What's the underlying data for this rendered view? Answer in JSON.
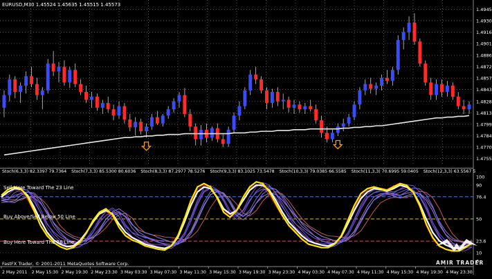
{
  "window": {
    "header": "EURUSD,M30 1.45524 1.45635 1.45515 1.45573",
    "copyright": "FastFX Trader, © 2001-2011 MetaQuotes Software Corp."
  },
  "watermark": {
    "text": "AMIR TRADER"
  },
  "colors": {
    "background": "#000000",
    "bull": "#3a4bff",
    "bear": "#ff2a2a",
    "ma": "#e8e8e8",
    "grid": "#8a8a8a",
    "axis_text": "#ffffff",
    "arrow": "#ff9a00",
    "level_high": "#3c78d8",
    "level_mid": "#e0c020",
    "level_low": "#ff3030"
  },
  "chart_data": [
    {
      "type": "candlestick",
      "title": "EURUSD,M30 1.45524 1.45635 1.45515 1.45573",
      "y_ticks": [
        "1.4945",
        "1.49305",
        "1.4916",
        "1.49015",
        "1.48865",
        "1.4872",
        "1.48575",
        "1.4843",
        "1.4828",
        "1.48135",
        "1.4799",
        "1.47845",
        "1.4770",
        "1.47555"
      ],
      "ylim": [
        1.4748,
        1.4955
      ],
      "candles": [
        [
          1.482,
          1.4842,
          1.4808,
          1.4836
        ],
        [
          1.4836,
          1.4862,
          1.4828,
          1.4856
        ],
        [
          1.4856,
          1.486,
          1.4832,
          1.484
        ],
        [
          1.484,
          1.4852,
          1.4826,
          1.4848
        ],
        [
          1.4848,
          1.4866,
          1.4838,
          1.486
        ],
        [
          1.486,
          1.4872,
          1.4846,
          1.485
        ],
        [
          1.485,
          1.4858,
          1.483,
          1.4836
        ],
        [
          1.4836,
          1.4846,
          1.4818,
          1.4842
        ],
        [
          1.4842,
          1.4882,
          1.4838,
          1.4876
        ],
        [
          1.4876,
          1.4892,
          1.486,
          1.4866
        ],
        [
          1.4866,
          1.4878,
          1.4852,
          1.4872
        ],
        [
          1.4872,
          1.488,
          1.4848,
          1.4852
        ],
        [
          1.4852,
          1.4872,
          1.4845,
          1.4868
        ],
        [
          1.4868,
          1.4876,
          1.4846,
          1.485
        ],
        [
          1.485,
          1.4856,
          1.4836,
          1.484
        ],
        [
          1.484,
          1.4848,
          1.4826,
          1.483
        ],
        [
          1.483,
          1.484,
          1.482,
          1.4834
        ],
        [
          1.4834,
          1.4838,
          1.4816,
          1.482
        ],
        [
          1.482,
          1.483,
          1.4812,
          1.4826
        ],
        [
          1.4826,
          1.4834,
          1.4814,
          1.4818
        ],
        [
          1.4818,
          1.4824,
          1.4804,
          1.481
        ],
        [
          1.481,
          1.4828,
          1.4806,
          1.4822
        ],
        [
          1.4822,
          1.4826,
          1.48,
          1.4805
        ],
        [
          1.4805,
          1.4812,
          1.479,
          1.4795
        ],
        [
          1.4795,
          1.4808,
          1.4785,
          1.4802
        ],
        [
          1.4802,
          1.4806,
          1.4786,
          1.479
        ],
        [
          1.479,
          1.48,
          1.4782,
          1.4796
        ],
        [
          1.4796,
          1.4812,
          1.4792,
          1.4808
        ],
        [
          1.4808,
          1.4816,
          1.4798,
          1.48
        ],
        [
          1.48,
          1.4812,
          1.4796,
          1.481
        ],
        [
          1.481,
          1.4822,
          1.4806,
          1.4818
        ],
        [
          1.4818,
          1.4832,
          1.4814,
          1.4828
        ],
        [
          1.4828,
          1.484,
          1.482,
          1.4836
        ],
        [
          1.4836,
          1.4845,
          1.4808,
          1.4812
        ],
        [
          1.4812,
          1.4818,
          1.479,
          1.4796
        ],
        [
          1.4796,
          1.48,
          1.4772,
          1.478
        ],
        [
          1.478,
          1.4798,
          1.4772,
          1.4792
        ],
        [
          1.4792,
          1.48,
          1.4776,
          1.4782
        ],
        [
          1.4782,
          1.4796,
          1.4778,
          1.4794
        ],
        [
          1.4794,
          1.48,
          1.4776,
          1.478
        ],
        [
          1.478,
          1.4786,
          1.477,
          1.4774
        ],
        [
          1.4774,
          1.4796,
          1.477,
          1.4792
        ],
        [
          1.4792,
          1.4814,
          1.4788,
          1.481
        ],
        [
          1.481,
          1.4828,
          1.4804,
          1.4822
        ],
        [
          1.4822,
          1.4846,
          1.4818,
          1.4842
        ],
        [
          1.4842,
          1.4868,
          1.4836,
          1.4862
        ],
        [
          1.4862,
          1.4872,
          1.485,
          1.4856
        ],
        [
          1.4856,
          1.486,
          1.4838,
          1.4842
        ],
        [
          1.4842,
          1.4846,
          1.4818,
          1.4826
        ],
        [
          1.4826,
          1.4844,
          1.482,
          1.484
        ],
        [
          1.484,
          1.4846,
          1.4822,
          1.4828
        ],
        [
          1.4828,
          1.4838,
          1.4818,
          1.483
        ],
        [
          1.483,
          1.4834,
          1.4814,
          1.482
        ],
        [
          1.482,
          1.483,
          1.4812,
          1.4824
        ],
        [
          1.4824,
          1.4828,
          1.4814,
          1.4818
        ],
        [
          1.4818,
          1.4826,
          1.4812,
          1.4822
        ],
        [
          1.4822,
          1.483,
          1.4815,
          1.4818
        ],
        [
          1.4818,
          1.4824,
          1.48,
          1.4804
        ],
        [
          1.4804,
          1.481,
          1.4782,
          1.4788
        ],
        [
          1.4788,
          1.4796,
          1.4776,
          1.478
        ],
        [
          1.478,
          1.4792,
          1.4776,
          1.4788
        ],
        [
          1.4788,
          1.48,
          1.4784,
          1.4796
        ],
        [
          1.4796,
          1.4806,
          1.479,
          1.48
        ],
        [
          1.48,
          1.4812,
          1.4796,
          1.4808
        ],
        [
          1.4808,
          1.4828,
          1.4804,
          1.4824
        ],
        [
          1.4824,
          1.4846,
          1.4818,
          1.4842
        ],
        [
          1.4842,
          1.4856,
          1.4836,
          1.485
        ],
        [
          1.485,
          1.4858,
          1.4838,
          1.4844
        ],
        [
          1.4844,
          1.4852,
          1.4836,
          1.4848
        ],
        [
          1.4848,
          1.4862,
          1.4842,
          1.4858
        ],
        [
          1.4858,
          1.4868,
          1.485,
          1.4854
        ],
        [
          1.4854,
          1.4872,
          1.4848,
          1.4868
        ],
        [
          1.4868,
          1.4912,
          1.4862,
          1.4906
        ],
        [
          1.4906,
          1.4922,
          1.4894,
          1.4916
        ],
        [
          1.4916,
          1.4936,
          1.4906,
          1.4928
        ],
        [
          1.4928,
          1.494,
          1.49,
          1.4904
        ],
        [
          1.4904,
          1.4908,
          1.4872,
          1.4876
        ],
        [
          1.4876,
          1.488,
          1.4848,
          1.4852
        ],
        [
          1.4852,
          1.4858,
          1.483,
          1.4836
        ],
        [
          1.4836,
          1.4856,
          1.483,
          1.485
        ],
        [
          1.485,
          1.4856,
          1.4834,
          1.484
        ],
        [
          1.484,
          1.4854,
          1.4834,
          1.4848
        ],
        [
          1.4848,
          1.4852,
          1.483,
          1.4834
        ],
        [
          1.4834,
          1.484,
          1.4818,
          1.4822
        ],
        [
          1.4822,
          1.483,
          1.4812,
          1.4818
        ],
        [
          1.4818,
          1.4828,
          1.4812,
          1.4824
        ]
      ],
      "moving_average": [
        1.476,
        1.4761,
        1.4762,
        1.4763,
        1.4764,
        1.4765,
        1.4766,
        1.4767,
        1.4768,
        1.4769,
        1.477,
        1.4771,
        1.4772,
        1.4773,
        1.4774,
        1.4775,
        1.4776,
        1.4777,
        1.4778,
        1.4779,
        1.478,
        1.4781,
        1.4782,
        1.4782,
        1.4783,
        1.4783,
        1.4784,
        1.4784,
        1.4785,
        1.4785,
        1.4786,
        1.4786,
        1.4786,
        1.4787,
        1.4787,
        1.4787,
        1.4787,
        1.4787,
        1.4787,
        1.4787,
        1.4787,
        1.4787,
        1.4788,
        1.4788,
        1.4788,
        1.4789,
        1.4789,
        1.479,
        1.479,
        1.479,
        1.4791,
        1.4791,
        1.4791,
        1.4792,
        1.4792,
        1.4792,
        1.4793,
        1.4793,
        1.4793,
        1.4793,
        1.4793,
        1.4793,
        1.4794,
        1.4794,
        1.4795,
        1.4795,
        1.4796,
        1.4796,
        1.4797,
        1.4797,
        1.4798,
        1.4799,
        1.48,
        1.4801,
        1.4802,
        1.4803,
        1.4804,
        1.4805,
        1.4806,
        1.4807,
        1.4807,
        1.4808,
        1.4808,
        1.4809,
        1.4809,
        1.481
      ],
      "arrows": [
        {
          "index": 26,
          "price": 1.4771
        },
        {
          "index": 61,
          "price": 1.4773
        }
      ]
    },
    {
      "type": "line",
      "header_labels": [
        "Stoch(6,3,3) 82.3397 79.7364",
        "Stoch(7,3,3) 85.5300 80.6036",
        "Stoch(8,3,3) 87.2977 78.5276",
        "Stoch(9,3,3) 83.1025 73.5478",
        "Stoch(10,3,3) 79.0385 66.5585",
        "Stoch(11,3,3) 70.6995 59.0405",
        "Stoch(12,3,3) 63.5567 52.5828",
        "Stoch(13,3,3) 49"
      ],
      "y_ticks": [
        "100",
        "90",
        "76.4",
        "50",
        "23.6",
        "10",
        "0"
      ],
      "ylim": [
        0,
        100
      ],
      "levels": [
        {
          "value": 76.4,
          "label": "Sell Here Toward The 23 Line"
        },
        {
          "value": 50,
          "label": "Buy Above/Sell Below 50 Line"
        },
        {
          "value": 23.6,
          "label": "Buy Here Toward The 76 Line"
        }
      ],
      "x_ticks": [
        "2 May 2011",
        "2 May 15:30",
        "2 May 19:30",
        "2 May 23:30",
        "3 May 03:30",
        "3 May 07:30",
        "3 May 11:30",
        "3 May 15:30",
        "3 May 19:30",
        "3 May 23:30",
        "4 May 03:30",
        "4 May 07:30",
        "4 May 11:30",
        "4 May 15:30",
        "4 May 19:30",
        "4 May 23:30"
      ],
      "main_series": [
        {
          "name": "Stoch(6,3,3)",
          "color": "#ffe400",
          "values": [
            78,
            85,
            88,
            86,
            76,
            60,
            42,
            30,
            22,
            17,
            14,
            16,
            22,
            33,
            48,
            58,
            62,
            55,
            40,
            30,
            25,
            22,
            18,
            16,
            14,
            13,
            18,
            30,
            50,
            72,
            88,
            92,
            88,
            75,
            58,
            52,
            60,
            76,
            88,
            94,
            92,
            82,
            68,
            54,
            42,
            34,
            26,
            20,
            18,
            16,
            16,
            20,
            30,
            48,
            66,
            80,
            86,
            88,
            86,
            84,
            88,
            92,
            90,
            82,
            66,
            44,
            28,
            18,
            14,
            12,
            12,
            16,
            22
          ]
        },
        {
          "name": "Stoch(7,3,3)",
          "color": "#ffffff",
          "values": [
            76,
            82,
            86,
            85,
            78,
            64,
            48,
            34,
            25,
            20,
            17,
            18,
            24,
            34,
            46,
            56,
            60,
            56,
            44,
            34,
            28,
            24,
            20,
            18,
            16,
            15,
            18,
            28,
            46,
            66,
            82,
            88,
            86,
            76,
            62,
            56,
            60,
            72,
            84,
            90,
            90,
            84,
            72,
            58,
            46,
            38,
            30,
            24,
            21,
            19,
            18,
            21,
            29,
            44,
            60,
            74,
            82,
            86,
            85,
            83,
            86,
            90,
            88,
            82,
            68,
            50,
            34,
            24,
            19,
            16,
            15,
            17,
            21
          ]
        }
      ],
      "fan_series": {
        "blue_count": 6,
        "red_count": 8,
        "spread": 8
      }
    }
  ]
}
